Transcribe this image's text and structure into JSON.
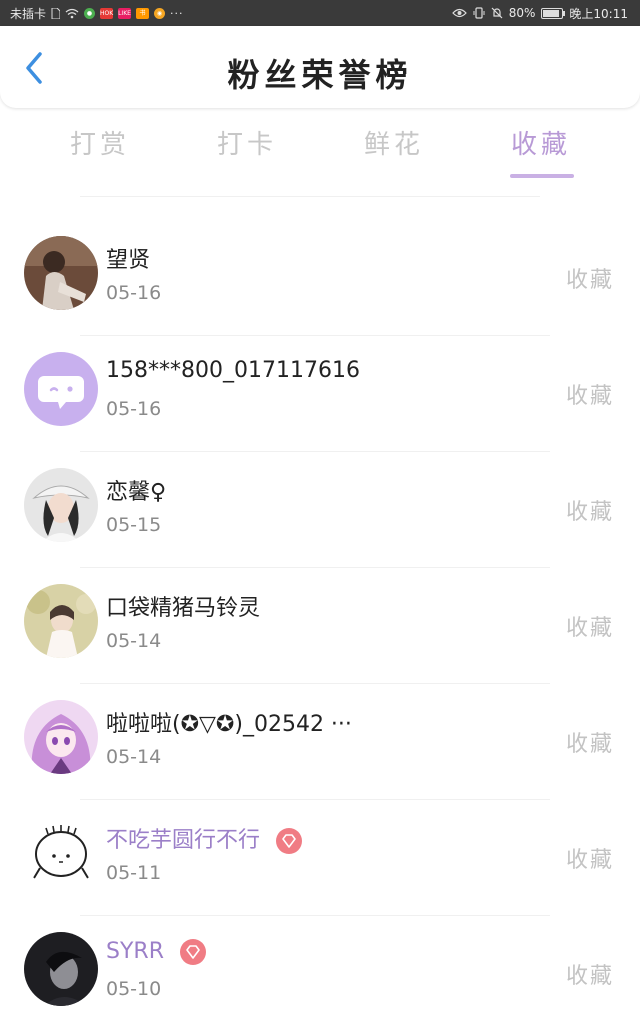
{
  "status_bar": {
    "carrier": "未插卡",
    "apps": [
      "HOK",
      "LIKE",
      "书"
    ],
    "more": "···",
    "battery": "80%",
    "time": "晚上10:11"
  },
  "header": {
    "title": "粉丝荣誉榜"
  },
  "tabs": [
    {
      "label": "打赏",
      "active": false
    },
    {
      "label": "打卡",
      "active": false
    },
    {
      "label": "鲜花",
      "active": false
    },
    {
      "label": "收藏",
      "active": true
    }
  ],
  "colors": {
    "accent": "#b89ad6",
    "vip_name": "#9b7fc8",
    "badge": "#f07c84",
    "muted": "#c3c3c3"
  },
  "fans": [
    {
      "name": "望贤",
      "date": "05-16",
      "action": "收藏",
      "vip": false,
      "avatar": "photo-girl-sitting"
    },
    {
      "name": "158***800_017117616",
      "date": "05-16",
      "action": "收藏",
      "vip": false,
      "avatar": "default-chat-avatar"
    },
    {
      "name": "恋馨♀",
      "date": "05-15",
      "action": "收藏",
      "vip": false,
      "avatar": "photo-girl-hat"
    },
    {
      "name": "口袋精猪马铃灵",
      "date": "05-14",
      "action": "收藏",
      "vip": false,
      "avatar": "photo-girl-garden"
    },
    {
      "name": "啦啦啦(✪▽✪)_02542 ···",
      "date": "05-14",
      "action": "收藏",
      "vip": false,
      "avatar": "anime-girl-purple"
    },
    {
      "name": "不吃芋圆行不行",
      "date": "05-11",
      "action": "收藏",
      "vip": true,
      "avatar": "doodle-face"
    },
    {
      "name": "SYRR",
      "date": "05-10",
      "action": "收藏",
      "vip": true,
      "avatar": "photo-boy-dark"
    }
  ]
}
